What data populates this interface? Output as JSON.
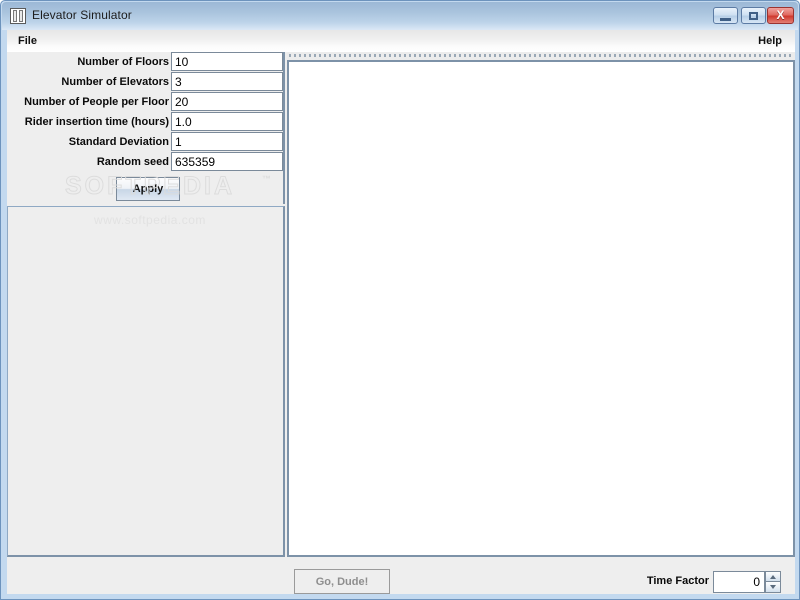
{
  "window": {
    "title": "Elevator Simulator",
    "icon": "elevator-doors-icon",
    "controls": {
      "minimize": "–",
      "maximize": "□",
      "close": "X"
    }
  },
  "menubar": {
    "items": [
      {
        "label": "File"
      },
      {
        "label": "Help"
      }
    ]
  },
  "form": {
    "rows": [
      {
        "label": "Number of Floors",
        "value": "10"
      },
      {
        "label": "Number of Elevators",
        "value": "3"
      },
      {
        "label": "Number of People per Floor",
        "value": "20"
      },
      {
        "label": "Rider insertion time (hours)",
        "value": "1.0"
      },
      {
        "label": "Standard Deviation",
        "value": "1"
      },
      {
        "label": "Random seed",
        "value": "635359"
      }
    ],
    "apply_label": "Apply"
  },
  "bottom": {
    "go_label": "Go, Dude!",
    "time_factor_label": "Time Factor",
    "time_factor_value": "0"
  },
  "watermark": {
    "brand": "SOFTPEDIA",
    "tm": "™",
    "url": "www.softpedia.com"
  },
  "colors": {
    "titlebar_top": "#9cb8d6",
    "titlebar_bottom": "#dbe8f6",
    "window_border": "#6d93bd",
    "frame_fill": "#c3d9ef",
    "panel_bg": "#eeeeee",
    "panel_border": "#7d92a8",
    "field_border": "#7b8a9a",
    "close_button": "#cf3a2f",
    "disabled_text": "#8e8e8e",
    "canvas_bg": "#ffffff"
  }
}
